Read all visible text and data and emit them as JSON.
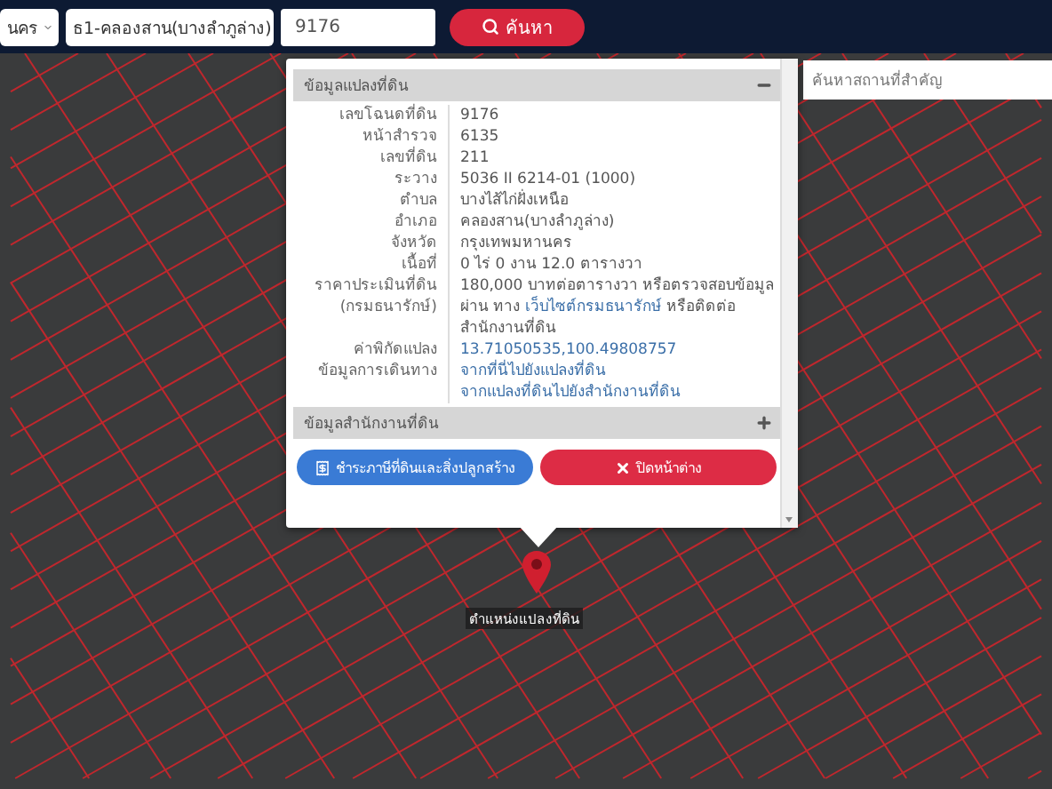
{
  "search_bar": {
    "province_select": "นคร",
    "district_select": "ธ1-คลองสาน(บางลำภูล่าง)",
    "parcel_input": "9176",
    "search_button": "ค้นหา"
  },
  "landmark_search": {
    "placeholder": "ค้นหาสถานที่สำคัญ"
  },
  "popup": {
    "sections": [
      {
        "title": "ข้อมูลแปลงที่ดิน",
        "expanded": true
      },
      {
        "title": "ข้อมูลสำนักงานที่ดิน",
        "expanded": false
      }
    ],
    "rows": [
      {
        "label": "เลขโฉนดที่ดิน",
        "lines": [
          [
            {
              "kind": "text",
              "text": "9176"
            }
          ]
        ]
      },
      {
        "label": "หน้าสำรวจ",
        "lines": [
          [
            {
              "kind": "text",
              "text": "6135"
            }
          ]
        ]
      },
      {
        "label": "เลขที่ดิน",
        "lines": [
          [
            {
              "kind": "text",
              "text": "211"
            }
          ]
        ]
      },
      {
        "label": "ระวาง",
        "lines": [
          [
            {
              "kind": "text",
              "text": "5036 II 6214-01 (1000)"
            }
          ]
        ]
      },
      {
        "label": "ตำบล",
        "lines": [
          [
            {
              "kind": "text",
              "text": "บางไส้ไก่ฝั่งเหนือ"
            }
          ]
        ]
      },
      {
        "label": "อำเภอ",
        "lines": [
          [
            {
              "kind": "text",
              "text": "คลองสาน(บางลำภูล่าง)"
            }
          ]
        ]
      },
      {
        "label": "จังหวัด",
        "lines": [
          [
            {
              "kind": "text",
              "text": "กรุงเทพมหานคร"
            }
          ]
        ]
      },
      {
        "label": "เนื้อที่",
        "lines": [
          [
            {
              "kind": "text",
              "text": "0 ไร่ 0 งาน 12.0 ตารางวา"
            }
          ]
        ]
      },
      {
        "label": "ราคาประเมินที่ดิน",
        "label_note": "(กรมธนารักษ์)",
        "lines": [
          [
            {
              "kind": "text",
              "text": "180,000 บาทต่อตารางวา หรือตรวจสอบข้อมูลผ่าน ทาง "
            },
            {
              "kind": "link",
              "text": "เว็บไซต์กรมธนารักษ์"
            },
            {
              "kind": "text",
              "text": " หรือติดต่อสำนักงานที่ดิน"
            }
          ]
        ]
      },
      {
        "label": "ค่าพิกัดแปลง",
        "lines": [
          [
            {
              "kind": "link",
              "text": "13.71050535,100.49808757"
            }
          ]
        ]
      },
      {
        "label": "ข้อมูลการเดินทาง",
        "lines": [
          [
            {
              "kind": "link",
              "text": "จากที่นี่ไปยังแปลงที่ดิน"
            }
          ],
          [
            {
              "kind": "link",
              "text": "จากแปลงที่ดินไปยังสำนักงานที่ดิน"
            }
          ]
        ]
      }
    ],
    "buttons": [
      {
        "kind": "primary",
        "label": "ชำระภาษีที่ดินและสิ่งปลูกสร้าง"
      },
      {
        "kind": "danger",
        "label": "ปิดหน้าต่าง"
      }
    ]
  },
  "marker": {
    "label": "ตำแหน่งแปลงที่ดิน"
  }
}
